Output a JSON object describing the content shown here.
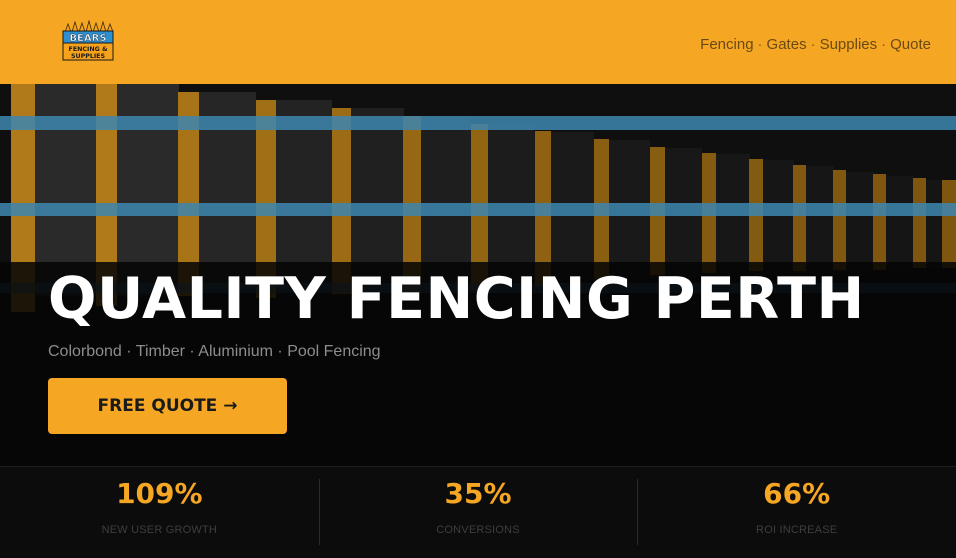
{
  "brand": {
    "logo_line1": "BEARS",
    "logo_line2": "FENCING &",
    "logo_line3": "SUPPLIES"
  },
  "nav": {
    "items": [
      "Fencing",
      "Gates",
      "Supplies",
      "Quote"
    ],
    "separator": "·"
  },
  "hero": {
    "title": "QUALITY FENCING PERTH",
    "subtitle": "Colorbond · Timber · Aluminium · Pool Fencing",
    "cta_label": "FREE QUOTE →",
    "background_image": "fence-perspective-illustration"
  },
  "stats": [
    {
      "value": "109%",
      "label": "NEW USER GROWTH"
    },
    {
      "value": "35%",
      "label": "CONVERSIONS"
    },
    {
      "value": "66%",
      "label": "ROI INCREASE"
    }
  ],
  "colors": {
    "accent": "#f5a623",
    "rail": "#3d86b0",
    "background": "#0f0f0f"
  }
}
